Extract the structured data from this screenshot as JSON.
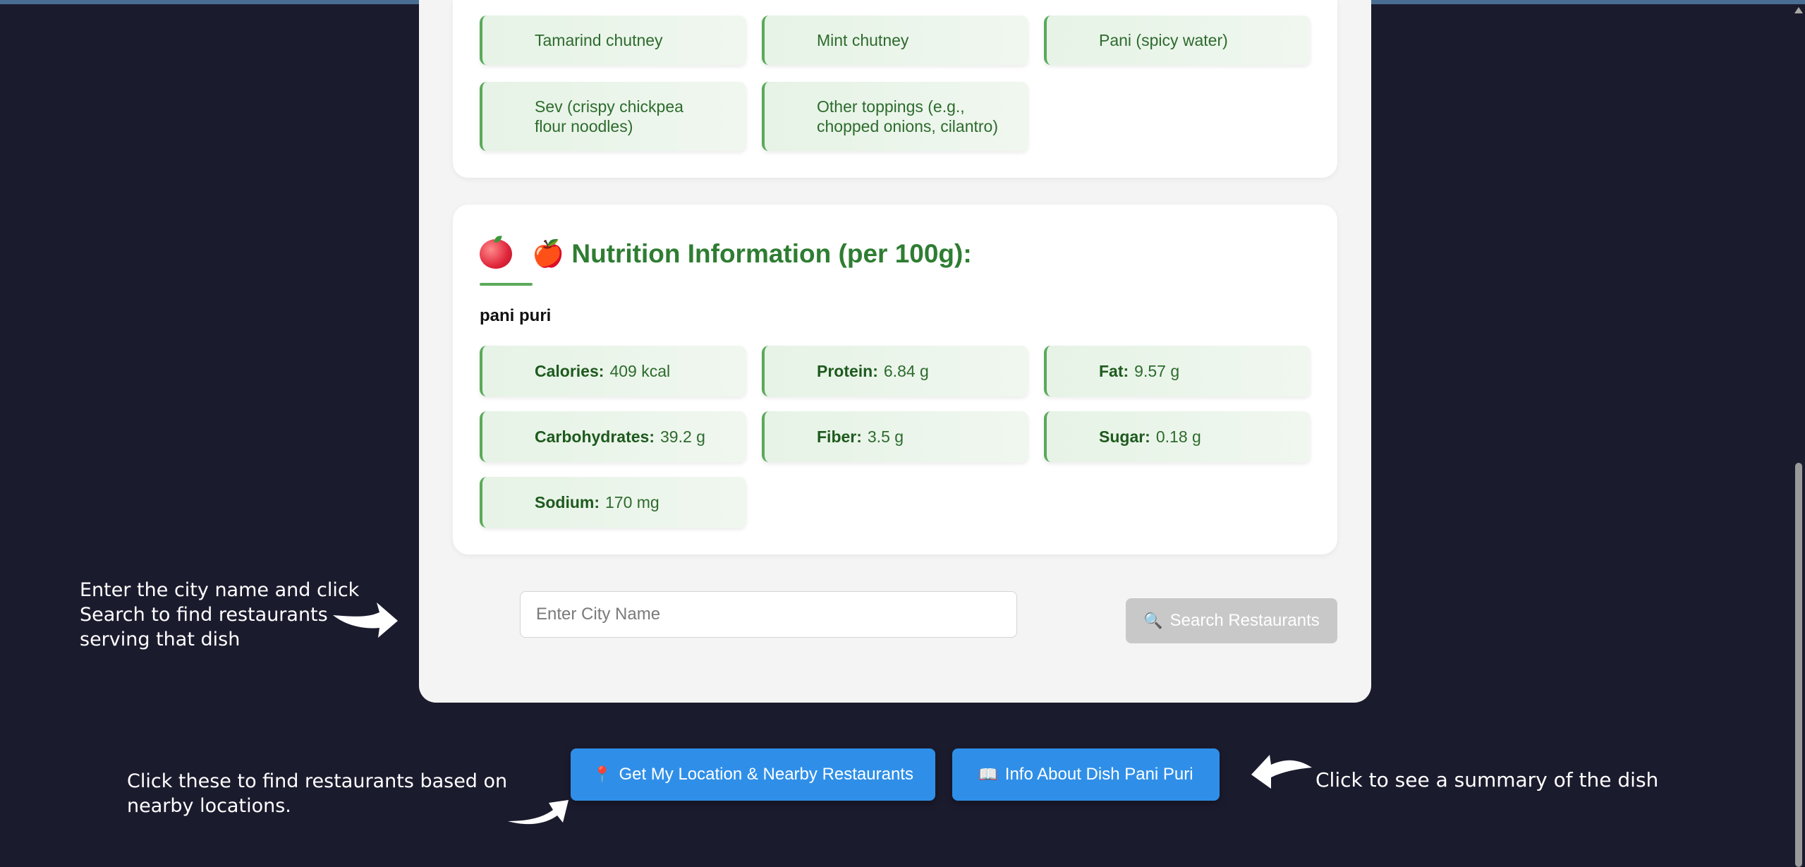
{
  "ingredients": [
    "Tamarind chutney",
    "Mint chutney",
    "Pani (spicy water)",
    "Sev (crispy chickpea flour noodles)",
    "Other toppings (e.g., chopped onions, cilantro)"
  ],
  "nutrition": {
    "title": "🍎 Nutrition Information (per 100g):",
    "icon": "apple-icon",
    "dish": "pani puri",
    "items": [
      {
        "label": "Calories:",
        "value": "409 kcal"
      },
      {
        "label": "Protein:",
        "value": "6.84 g"
      },
      {
        "label": "Fat:",
        "value": "9.57 g"
      },
      {
        "label": "Carbohydrates:",
        "value": "39.2 g"
      },
      {
        "label": "Fiber:",
        "value": "3.5 g"
      },
      {
        "label": "Sugar:",
        "value": "0.18 g"
      },
      {
        "label": "Sodium:",
        "value": "170 mg"
      }
    ]
  },
  "search": {
    "placeholder": "Enter City Name",
    "button_label": "Search Restaurants",
    "button_icon": "🔍"
  },
  "actions": {
    "location_label": "Get My Location & Nearby Restaurants",
    "location_icon": "📍",
    "info_label": "Info About Dish Pani Puri",
    "info_icon": "📖"
  },
  "annotations": {
    "city_note": "Enter the city name and click Search to find restaurants serving that dish",
    "location_note": "Click these to find restaurants based on nearby locations.",
    "info_note": "Click to see a summary of the dish"
  },
  "colors": {
    "background": "#1b1b2e",
    "accent_green": "#2e7d32",
    "button_blue": "#2f8fe8",
    "button_disabled": "#c8c8c8"
  }
}
